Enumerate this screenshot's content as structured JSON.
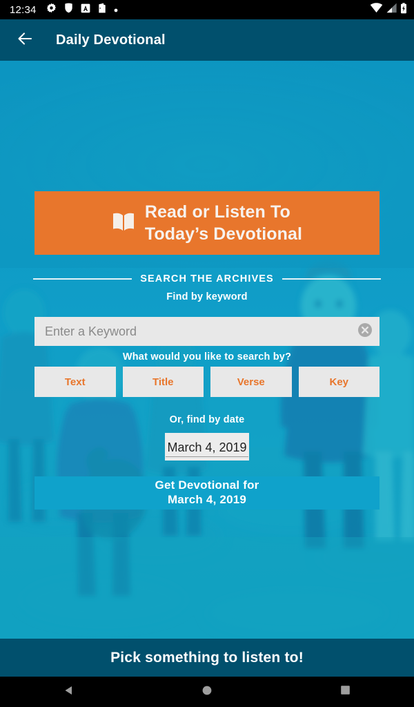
{
  "status_bar": {
    "time": "12:34",
    "left_icons": [
      "gear-icon",
      "shield-icon",
      "app-badge-a-icon",
      "door-icon",
      "dot-icon"
    ],
    "right_icons": [
      "wifi-icon",
      "cell-signal-icon",
      "battery-icon"
    ]
  },
  "app_bar": {
    "back_icon": "back-arrow-icon",
    "title": "Daily Devotional"
  },
  "main": {
    "cta": {
      "icon": "open-book-icon",
      "line1": "Read or Listen To",
      "line2": "Today’s Devotional"
    },
    "divider_label": "SEARCH THE ARCHIVES",
    "keyword": {
      "label": "Find by keyword",
      "placeholder": "Enter a Keyword",
      "value": "",
      "clear_icon": "clear-circle-icon"
    },
    "search_by": {
      "label": "What would you like to search by?",
      "options": [
        "Text",
        "Title",
        "Verse",
        "Key"
      ]
    },
    "date": {
      "label": "Or, find by date",
      "value": "March 4, 2019"
    },
    "get_button": {
      "line1": "Get Devotional for",
      "line2": "March 4, 2019"
    }
  },
  "bottom_banner": {
    "text": "Pick something to listen to!"
  },
  "nav_bar": {
    "back": "nav-back-icon",
    "home": "nav-home-icon",
    "recents": "nav-recents-icon"
  },
  "colors": {
    "app_bar": "#01506d",
    "accent_orange": "#e8762c",
    "background_teal": "#0f9cc6",
    "get_button": "#0fa2cb",
    "chip_bg": "#e8e8e8"
  }
}
